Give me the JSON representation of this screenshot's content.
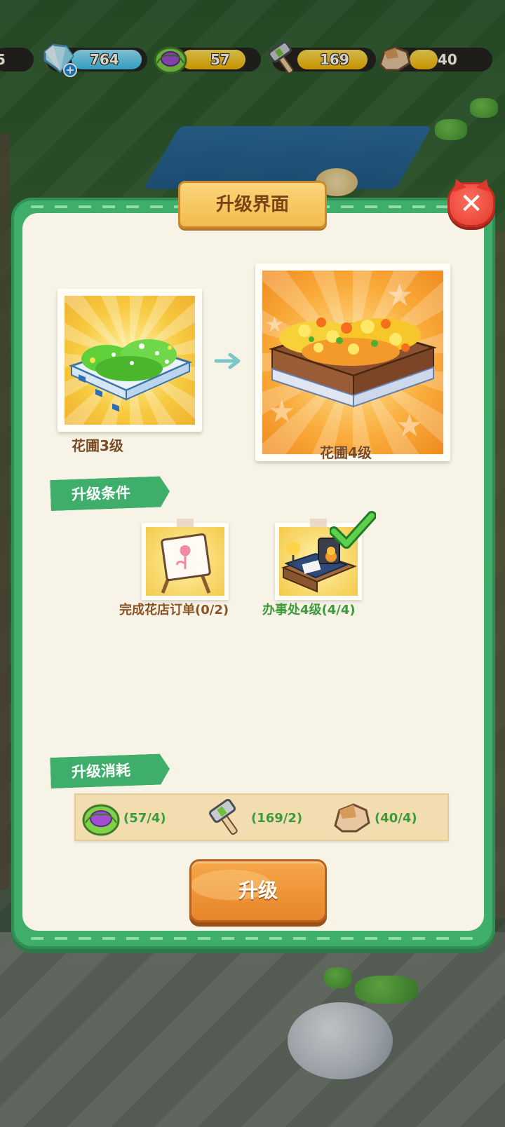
{
  "resources": {
    "partial_value": "5",
    "gems": "764",
    "cabbage": "57",
    "hammer": "169",
    "stone": "40"
  },
  "dialog": {
    "title": "升级界面",
    "current_level_label": "花圃3级",
    "next_level_label": "花圃4级",
    "conditions_header": "升级条件",
    "conditions": [
      {
        "label": "完成花店订单(0/2)",
        "met": false,
        "icon": "flower-sign-icon"
      },
      {
        "label": "办事处4级(4/4)",
        "met": true,
        "icon": "office-desk-icon"
      }
    ],
    "cost_header": "升级消耗",
    "costs": [
      {
        "icon": "cabbage-icon",
        "label": "(57/4)"
      },
      {
        "icon": "hammer-icon",
        "label": "(169/2)"
      },
      {
        "icon": "stone-icon",
        "label": "(40/4)"
      }
    ],
    "upgrade_button": "升级"
  },
  "colors": {
    "panel_green": "#3fae6b",
    "panel_inner": "#f7f3e6",
    "met_text": "#3c9a3c",
    "unmet_text": "#8a5326",
    "button_orange": "#e8852a",
    "close_red": "#e0392c"
  }
}
